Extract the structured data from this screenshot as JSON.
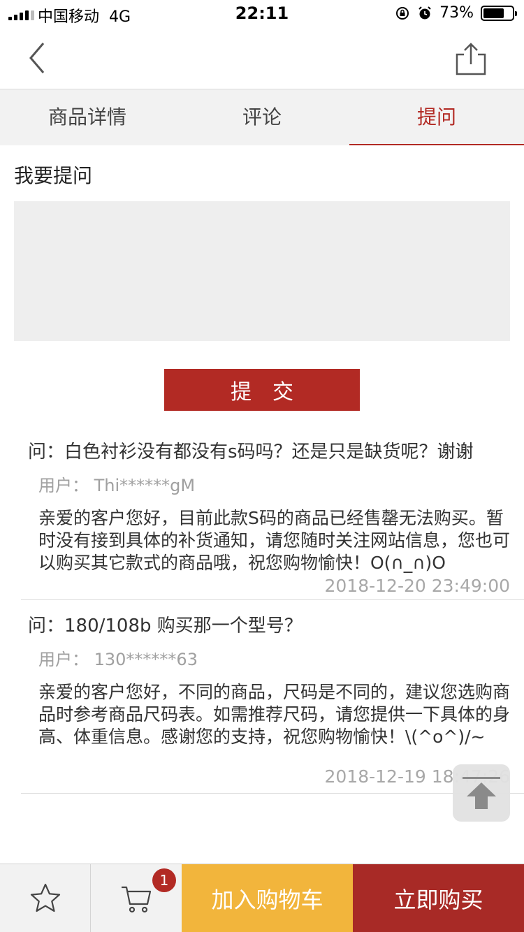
{
  "status_bar": {
    "carrier": "中国移动",
    "network": "4G",
    "time": "22:11",
    "battery": "73%",
    "battery_level": 0.73
  },
  "nav": {
    "back_icon": "chevron-left-icon",
    "share_icon": "share-icon"
  },
  "tabs": [
    {
      "label": "商品详情",
      "active": false
    },
    {
      "label": "评论",
      "active": false
    },
    {
      "label": "提问",
      "active": true
    }
  ],
  "ask": {
    "label": "我要提问",
    "placeholder": "",
    "submit_label": "提交"
  },
  "qa": [
    {
      "question": "问：白色衬衫没有都没有s码吗？还是只是缺货呢？谢谢",
      "user": "用户：  Thi******gM",
      "answer": "亲爱的客户您好，目前此款S码的商品已经售罄无法购买。暂时没有接到具体的补货通知，请您随时关注网站信息，您也可以购买其它款式的商品哦，祝您购物愉快！O(∩_∩)O",
      "date": "2018-12-20 23:49:00"
    },
    {
      "question": "问：180/108b 购买那一个型号？",
      "user": "用户：  130******63",
      "answer": "亲爱的客户您好，不同的商品，尺码是不同的，建议您选购商品时参考商品尺码表。如需推荐尺码，请您提供一下具体的身高、体重信息。感谢您的支持，祝您购物愉快！\\(^o^)/~",
      "date": "2018-12-19 18:47:26"
    }
  ],
  "bottom_bar": {
    "favorite_icon": "star-icon",
    "cart_icon": "cart-icon",
    "cart_count": "1",
    "add_to_cart": "加入购物车",
    "buy_now": "立即购买"
  },
  "colors": {
    "accent_red": "#b22a24",
    "add_to_cart_yellow": "#f2b53c",
    "buy_now_red": "#a82a26"
  }
}
